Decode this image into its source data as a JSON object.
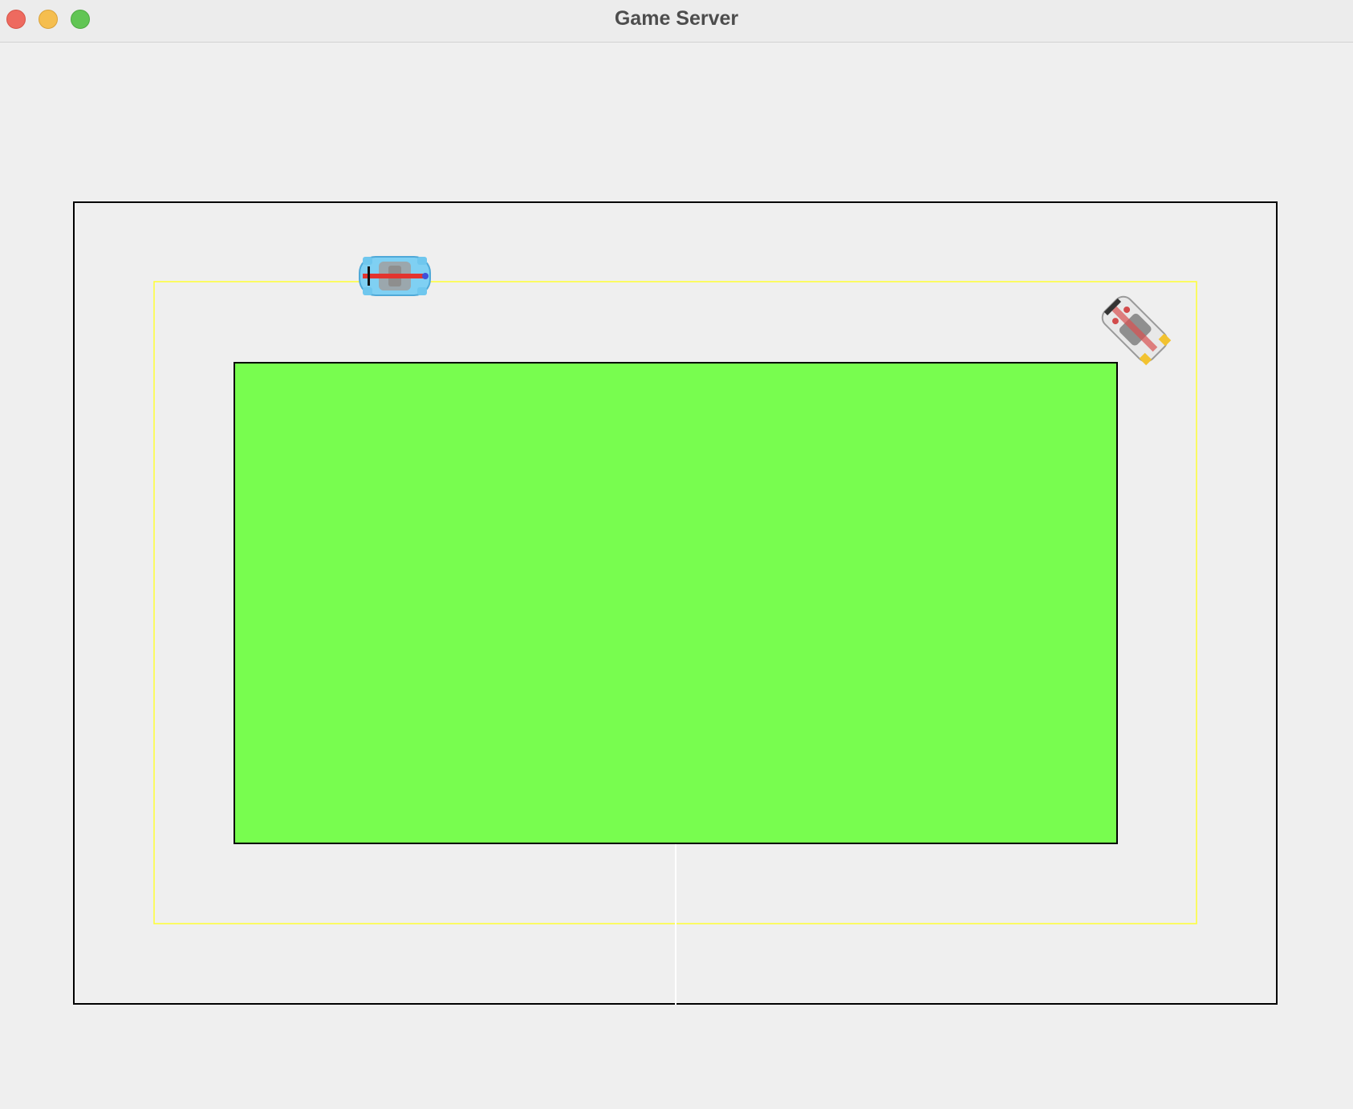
{
  "window": {
    "title": "Game Server"
  },
  "colors": {
    "background": "#efefef",
    "track_border": "#000000",
    "infield": "#78fd4f",
    "racing_line": "#ffff33",
    "finish_line": "#ffffff",
    "car_blue": "#7fd0f3",
    "car_white": "#e8e8e8"
  },
  "icons": {
    "close": "close-icon",
    "minimize": "minimize-icon",
    "zoom": "zoom-icon",
    "player_car": "blue-race-car-icon",
    "opponent_car": "white-race-car-icon"
  }
}
